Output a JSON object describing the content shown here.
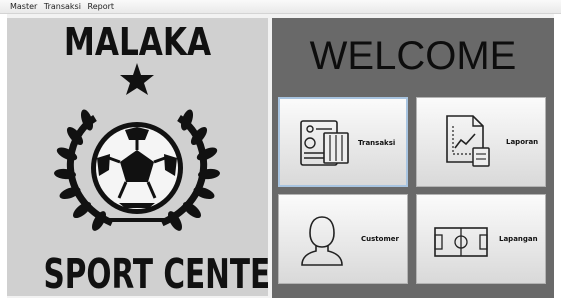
{
  "menubar": {
    "items": [
      "Master",
      "Transaksi",
      "Report"
    ]
  },
  "logo": {
    "title_top": "MALAKA",
    "title_bottom": "SPORT CENTER"
  },
  "welcome": "WELCOME",
  "buttons": {
    "transaksi": "Transaksi",
    "laporan": "Laporan",
    "customer": "Customer",
    "lapangan": "Lapangan"
  }
}
